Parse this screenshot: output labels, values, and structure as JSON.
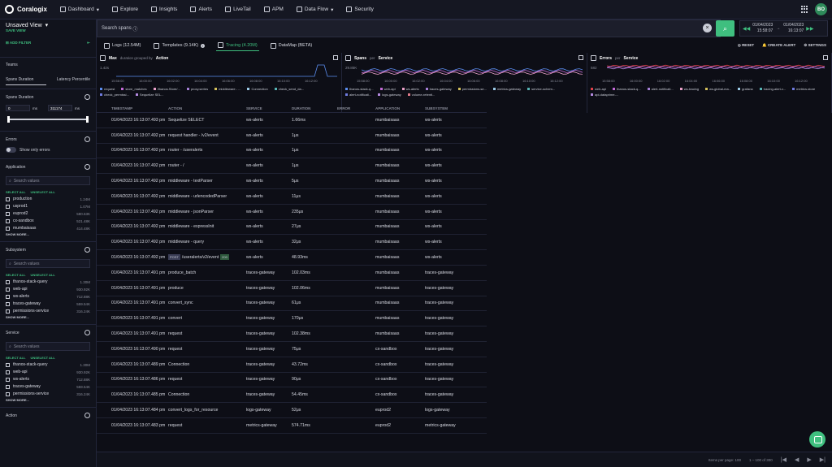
{
  "brand": {
    "name": "Coralogix",
    "avatar": "BO"
  },
  "nav": [
    {
      "label": "Dashboard",
      "icon": "dashboard-icon",
      "caret": true
    },
    {
      "label": "Explore",
      "icon": "explore-icon",
      "caret": false
    },
    {
      "label": "Insights",
      "icon": "insights-icon",
      "caret": false
    },
    {
      "label": "Alerts",
      "icon": "bell-icon",
      "caret": false
    },
    {
      "label": "LiveTail",
      "icon": "livetail-icon",
      "caret": false
    },
    {
      "label": "APM",
      "icon": "apm-icon",
      "caret": false
    },
    {
      "label": "Data Flow",
      "icon": "dataflow-icon",
      "caret": true
    },
    {
      "label": "Security",
      "icon": "shield-icon",
      "caret": false
    }
  ],
  "sidebar": {
    "view_title": "Unsaved View",
    "save_view": "SAVE VIEW",
    "add_filter": "ADD FILTER",
    "teams": "Teams",
    "tab_duration": "Spans Duration",
    "tab_latency": "Latency Percentile",
    "spans_duration": "Spans Duration",
    "dur_min": "0",
    "dur_max": "311174",
    "dur_unit": "ms",
    "errors": "Errors",
    "show_only_errors": "Show only errors",
    "search_placeholder": "Search values",
    "select_all": "SELECT ALL",
    "unselect_all": "UNSELECT ALL",
    "show_more": "SHOW MORE...",
    "application": {
      "title": "Application",
      "items": [
        {
          "name": "production",
          "count": "1.24M"
        },
        {
          "name": "usprod1",
          "count": "1.07M"
        },
        {
          "name": "euprod2",
          "count": "580.63K"
        },
        {
          "name": "cx-sandbox",
          "count": "521.48K"
        },
        {
          "name": "mumbaisaas",
          "count": "414.48K"
        }
      ]
    },
    "subsystem": {
      "title": "Subsystem",
      "items": [
        {
          "name": "thanos-stack-query",
          "count": "1.30M"
        },
        {
          "name": "web-api",
          "count": "930.92K"
        },
        {
          "name": "ws-alerts",
          "count": "712.88K"
        },
        {
          "name": "traces-gateway",
          "count": "559.54K"
        },
        {
          "name": "permissions-service",
          "count": "316.24K"
        }
      ]
    },
    "service": {
      "title": "Service",
      "items": [
        {
          "name": "thanos-stack-query",
          "count": "1.30M"
        },
        {
          "name": "web-api",
          "count": "930.92K"
        },
        {
          "name": "ws-alerts",
          "count": "712.88K"
        },
        {
          "name": "traces-gateway",
          "count": "559.54K"
        },
        {
          "name": "permissions-service",
          "count": "316.24K"
        }
      ]
    },
    "action": "Action"
  },
  "searchbar": {
    "placeholder": "Search spans"
  },
  "time": {
    "from_date": "01/04/2023",
    "from_time": "15:58:07",
    "to_date": "01/04/2023",
    "to_time": "16:13:07"
  },
  "tabs": [
    {
      "label": "Logs (12.54M)",
      "icon": "logs-icon",
      "badge": "",
      "active": false
    },
    {
      "label": "Templates (9.14K)",
      "icon": "templates-icon",
      "badge": "!",
      "active": false
    },
    {
      "label": "Tracing (4.20M)",
      "icon": "tracing-icon",
      "badge": "",
      "active": true
    },
    {
      "label": "DataMap (BETA)",
      "icon": "datamap-icon",
      "badge": "",
      "active": false
    }
  ],
  "actions": {
    "reset": "RESET",
    "create_alert": "CREATE ALERT",
    "settings": "SETTINGS"
  },
  "charts": [
    {
      "title_bold": "Max",
      "title_rest": "duration grouped by",
      "group": "Action",
      "ymax": "1.42s",
      "ticks": [
        "15:58:00",
        "16:00:00",
        "16:02:00",
        "16:04:00",
        "16:06:00",
        "16:08:00",
        "16:10:00",
        "16:12:00"
      ],
      "legend": [
        {
          "label": "request",
          "color": "#5b8def"
        },
        {
          "label": "store_matches",
          "color": "#c46ad8"
        },
        {
          "label": "/thanos.Store/...",
          "color": "#e8a0c8"
        },
        {
          "label": "proxy.series",
          "color": "#a57fd6"
        },
        {
          "label": "middleware - ...",
          "color": "#d4c05b"
        },
        {
          "label": "Connection",
          "color": "#9ccbe8"
        },
        {
          "label": "check_send_da...",
          "color": "#56b4b4"
        },
        {
          "label": "check_permissi...",
          "color": "#6f7be0"
        },
        {
          "label": "Sequelize SEL...",
          "color": "#b48ae0"
        }
      ]
    },
    {
      "title_bold": "Spans",
      "title_rest": "per",
      "group": "Service",
      "ymax": "29.85K",
      "ticks": [
        "15:58:00",
        "16:00:00",
        "16:02:00",
        "16:04:00",
        "16:06:00",
        "16:08:00",
        "16:10:00",
        "16:12:00"
      ],
      "legend": [
        {
          "label": "thanos-stack-q...",
          "color": "#5b8def"
        },
        {
          "label": "web-api",
          "color": "#c46ad8"
        },
        {
          "label": "ws-alerts",
          "color": "#e8a0c8"
        },
        {
          "label": "traces-gateway",
          "color": "#a57fd6"
        },
        {
          "label": "permissions-se...",
          "color": "#d4c05b"
        },
        {
          "label": "metrics-gateway",
          "color": "#9ccbe8"
        },
        {
          "label": "service-schem...",
          "color": "#56b4b4"
        },
        {
          "label": "alert-notificati...",
          "color": "#6f7be0"
        },
        {
          "label": "logs-gateway",
          "color": "#b48ae0"
        },
        {
          "label": "volume-retenti...",
          "color": "#e07b8a"
        }
      ]
    },
    {
      "title_bold": "Errors",
      "title_rest": "per",
      "group": "Service",
      "ymax": "582",
      "ticks": [
        "15:58:00",
        "16:00:00",
        "16:02:00",
        "16:04:00",
        "16:06:00",
        "16:08:00",
        "16:10:00",
        "16:12:00"
      ],
      "legend": [
        {
          "label": "web-api",
          "color": "#e0404a"
        },
        {
          "label": "thanos-stack-q...",
          "color": "#c46ad8"
        },
        {
          "label": "alert-notificati...",
          "color": "#a57fd6"
        },
        {
          "label": "ws-tracing",
          "color": "#e8a0c8"
        },
        {
          "label": "ws-global-ma...",
          "color": "#d4c05b"
        },
        {
          "label": "grafana",
          "color": "#9ccbe8"
        },
        {
          "label": "tracing-alert-v...",
          "color": "#56b4b4"
        },
        {
          "label": "metrics-store",
          "color": "#6f7be0"
        },
        {
          "label": "api-dataprime-...",
          "color": "#b48ae0"
        }
      ]
    }
  ],
  "table": {
    "headers": [
      "TIMESTAMP",
      "ACTION",
      "SERVICE",
      "DURATION",
      "ERROR",
      "APPLICATION",
      "SUBSYSTEM"
    ],
    "rows": [
      {
        "ts": "01/04/2023 16:13:07.493 pm",
        "action": "Sequelize SELECT",
        "method": "",
        "status": "",
        "service": "ws-alerts",
        "duration": "1.66ms",
        "error": "",
        "app": "mumbaisaas",
        "sub": "ws-alerts"
      },
      {
        "ts": "01/04/2023 16:13:07.492 pm",
        "action": "request handler - /v2/event",
        "method": "",
        "status": "",
        "service": "ws-alerts",
        "duration": "1μs",
        "error": "",
        "app": "mumbaisaas",
        "sub": "ws-alerts"
      },
      {
        "ts": "01/04/2023 16:13:07.492 pm",
        "action": "router - /useralerts",
        "method": "",
        "status": "",
        "service": "ws-alerts",
        "duration": "1μs",
        "error": "",
        "app": "mumbaisaas",
        "sub": "ws-alerts"
      },
      {
        "ts": "01/04/2023 16:13:07.492 pm",
        "action": "router - /",
        "method": "",
        "status": "",
        "service": "ws-alerts",
        "duration": "1μs",
        "error": "",
        "app": "mumbaisaas",
        "sub": "ws-alerts"
      },
      {
        "ts": "01/04/2023 16:13:07.492 pm",
        "action": "middleware - textParser",
        "method": "",
        "status": "",
        "service": "ws-alerts",
        "duration": "5μs",
        "error": "",
        "app": "mumbaisaas",
        "sub": "ws-alerts"
      },
      {
        "ts": "01/04/2023 16:13:07.492 pm",
        "action": "middleware - urlencodedParser",
        "method": "",
        "status": "",
        "service": "ws-alerts",
        "duration": "11μs",
        "error": "",
        "app": "mumbaisaas",
        "sub": "ws-alerts"
      },
      {
        "ts": "01/04/2023 16:13:07.492 pm",
        "action": "middleware - jsonParser",
        "method": "",
        "status": "",
        "service": "ws-alerts",
        "duration": "235μs",
        "error": "",
        "app": "mumbaisaas",
        "sub": "ws-alerts"
      },
      {
        "ts": "01/04/2023 16:13:07.492 pm",
        "action": "middleware - expressInit",
        "method": "",
        "status": "",
        "service": "ws-alerts",
        "duration": "27μs",
        "error": "",
        "app": "mumbaisaas",
        "sub": "ws-alerts"
      },
      {
        "ts": "01/04/2023 16:13:07.492 pm",
        "action": "middleware - query",
        "method": "",
        "status": "",
        "service": "ws-alerts",
        "duration": "32μs",
        "error": "",
        "app": "mumbaisaas",
        "sub": "ws-alerts"
      },
      {
        "ts": "01/04/2023 16:13:07.492 pm",
        "action": "/useralerts/v2/event",
        "method": "POST",
        "status": "200",
        "service": "ws-alerts",
        "duration": "48.93ms",
        "error": "",
        "app": "mumbaisaas",
        "sub": "ws-alerts"
      },
      {
        "ts": "01/04/2023 16:13:07.491 pm",
        "action": "produce_batch",
        "method": "",
        "status": "",
        "service": "traces-gateway",
        "duration": "102.03ms",
        "error": "",
        "app": "mumbaisaas",
        "sub": "traces-gateway"
      },
      {
        "ts": "01/04/2023 16:13:07.491 pm",
        "action": "produce",
        "method": "",
        "status": "",
        "service": "traces-gateway",
        "duration": "102.06ms",
        "error": "",
        "app": "mumbaisaas",
        "sub": "traces-gateway"
      },
      {
        "ts": "01/04/2023 16:13:07.491 pm",
        "action": "convert_sync",
        "method": "",
        "status": "",
        "service": "traces-gateway",
        "duration": "61μs",
        "error": "",
        "app": "mumbaisaas",
        "sub": "traces-gateway"
      },
      {
        "ts": "01/04/2023 16:13:07.491 pm",
        "action": "convert",
        "method": "",
        "status": "",
        "service": "traces-gateway",
        "duration": "170μs",
        "error": "",
        "app": "mumbaisaas",
        "sub": "traces-gateway"
      },
      {
        "ts": "01/04/2023 16:13:07.491 pm",
        "action": "request",
        "method": "",
        "status": "",
        "service": "traces-gateway",
        "duration": "102.38ms",
        "error": "",
        "app": "mumbaisaas",
        "sub": "traces-gateway"
      },
      {
        "ts": "01/04/2023 16:13:07.490 pm",
        "action": "request",
        "method": "",
        "status": "",
        "service": "traces-gateway",
        "duration": "75μs",
        "error": "",
        "app": "cx-sandbox",
        "sub": "traces-gateway"
      },
      {
        "ts": "01/04/2023 16:13:07.489 pm",
        "action": "Connection",
        "method": "",
        "status": "",
        "service": "traces-gateway",
        "duration": "43.72ms",
        "error": "",
        "app": "cx-sandbox",
        "sub": "traces-gateway"
      },
      {
        "ts": "01/04/2023 16:13:07.486 pm",
        "action": "request",
        "method": "",
        "status": "",
        "service": "traces-gateway",
        "duration": "90μs",
        "error": "",
        "app": "cx-sandbox",
        "sub": "traces-gateway"
      },
      {
        "ts": "01/04/2023 16:13:07.485 pm",
        "action": "Connection",
        "method": "",
        "status": "",
        "service": "traces-gateway",
        "duration": "54.45ms",
        "error": "",
        "app": "cx-sandbox",
        "sub": "traces-gateway"
      },
      {
        "ts": "01/04/2023 16:13:07.484 pm",
        "action": "convert_logs_for_resource",
        "method": "",
        "status": "",
        "service": "logs-gateway",
        "duration": "52μs",
        "error": "",
        "app": "euprod2",
        "sub": "logs-gateway"
      },
      {
        "ts": "01/04/2023 16:13:07.483 pm",
        "action": "request",
        "method": "",
        "status": "",
        "service": "metrics-gateway",
        "duration": "574.71ms",
        "error": "",
        "app": "euprod2",
        "sub": "metrics-gateway"
      }
    ]
  },
  "pager": {
    "items_per_page": "Items per page: 100",
    "range": "1 – 100 of 300"
  }
}
